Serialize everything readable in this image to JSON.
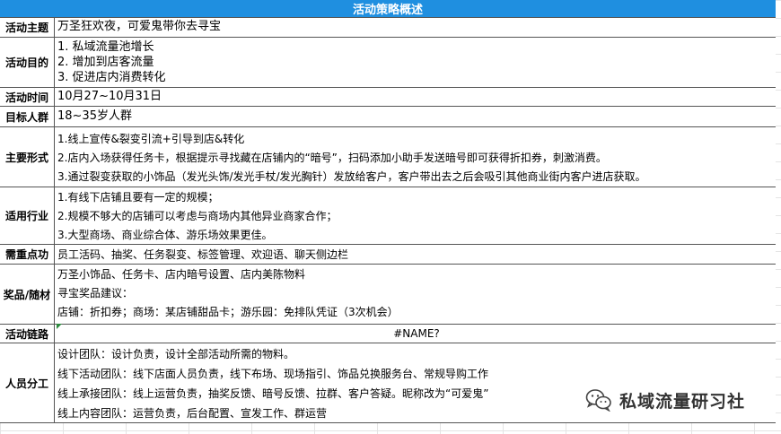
{
  "title": "活动策略概述",
  "rows": [
    {
      "label": "活动主题",
      "lines": [
        "万圣狂欢夜，可爱鬼带你去寻宝"
      ]
    },
    {
      "label": "活动目的",
      "lines": [
        "1. 私域流量池增长",
        "2. 增加到店客流量",
        "3. 促进店内消费转化"
      ]
    },
    {
      "label": "活动时间",
      "lines": [
        "10月27~10月31日"
      ]
    },
    {
      "label": "目标人群",
      "lines": [
        "18~35岁人群"
      ]
    },
    {
      "label": "主要形式",
      "lines": [
        "1.线上宣传&裂变引流+引导到店&转化",
        "2.店内入场获得任务卡，根据提示寻找藏在店铺内的“暗号”，扫码添加小助手发送暗号即可获得折扣券，刺激消费。",
        "3.通过裂变获取的小饰品（发光头饰/发光手杖/发光胸针）发放给客户，客户带出去之后会吸引其他商业街内客户进店获取。"
      ]
    },
    {
      "label": "适用行业",
      "lines": [
        "1.有线下店铺且要有一定的规模；",
        "2.规模不够大的店铺可以考虑与商场内其他异业商家合作；",
        "3.大型商场、商业综合体、游乐场效果更佳。"
      ]
    },
    {
      "label": "需重点功",
      "lines": [
        "员工活码、抽奖、任务裂变、标签管理、欢迎语、聊天侧边栏"
      ]
    },
    {
      "label": "奖品/随材",
      "lines": [
        "万圣小饰品、任务卡、店内暗号设置、店内美陈物料",
        "寻宝奖品建议：",
        "店铺：折扣券；商场：某店铺甜品卡；游乐园：免排队凭证（3次机会）"
      ]
    },
    {
      "label": "活动链路",
      "lines": [
        "#NAME?"
      ]
    },
    {
      "label": "人员分工",
      "lines": [
        "设计团队：设计负责，设计全部活动所需的物料。",
        "线下活动团队：线下店面人员负责，线下布场、现场指引、饰品兑换服务台、常规导购工作",
        "线上承接团队：线上运营负责，抽奖反馈、暗号反馈、拉群、客户答疑。昵称改为“可爱鬼”",
        "线上内容团队：运营负责，后台配置、宣发工作、群运营"
      ]
    }
  ],
  "watermark": {
    "text": "私域流量研习社",
    "icon": "wechat-icon"
  },
  "colors": {
    "header_bg": "#1f8fe0",
    "error_marker": "#2c8a3e"
  }
}
